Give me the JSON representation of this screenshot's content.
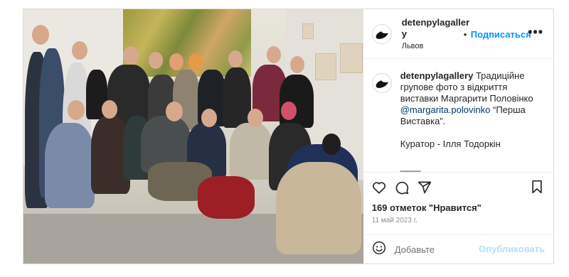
{
  "post": {
    "username": "detenpylagallery",
    "location": "Львов",
    "follow_dot": "•",
    "follow_label": "Подписаться",
    "more_label": "•••",
    "caption_user": "detenpylagallery",
    "caption_text_1": " Традиційне групове фото з відкриття виставки Маргарити Половінко ",
    "caption_mention": "@margarita.polovinko",
    "caption_text_2": " “Перша Виставка”.\n\nКуратор - Ілля Тодоркін\n\n____\n\nДякуємо за фінасову підтримку:",
    "likes": "169 отметок \"Нравится\"",
    "date": "11 май 2023 г.",
    "add_comment_placeholder": "Добавьте",
    "publish_label": "Опубликовать"
  },
  "icons": {
    "like": "heart-icon",
    "comment": "comment-icon",
    "share": "send-icon",
    "save": "bookmark-icon",
    "emoji": "emoji-icon"
  },
  "colors": {
    "accent": "#0095f6",
    "publish_disabled": "#b2dffc"
  }
}
